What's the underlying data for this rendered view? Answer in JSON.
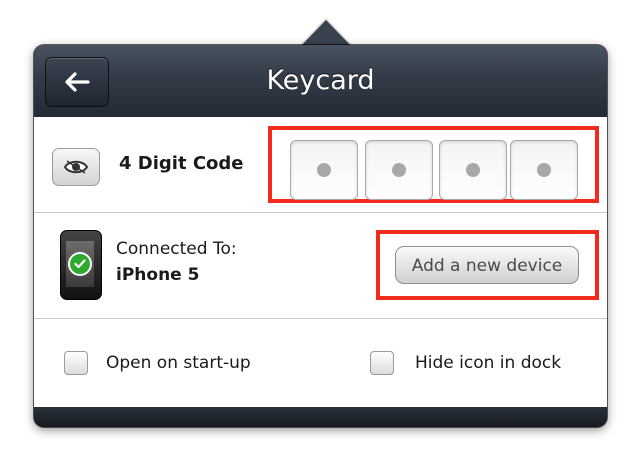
{
  "header": {
    "title": "Keycard",
    "back_icon": "arrow-left-icon"
  },
  "code": {
    "toggle_icon": "eye-icon",
    "label": "4 Digit Code",
    "digits": [
      {
        "masked": true
      },
      {
        "masked": true
      },
      {
        "masked": true
      },
      {
        "masked": true
      }
    ]
  },
  "device": {
    "icon": "iphone-icon",
    "status_icon": "checkmark-icon",
    "connected_label": "Connected To:",
    "device_name": "iPhone 5",
    "add_button_label": "Add a new device"
  },
  "options": {
    "startup": {
      "label": "Open on start-up",
      "checked": false
    },
    "dock": {
      "label": "Hide icon in dock",
      "checked": false
    }
  },
  "colors": {
    "highlight": "#f12b1d",
    "header_bg": "#2b323e",
    "status_green": "#2eaa2e"
  }
}
